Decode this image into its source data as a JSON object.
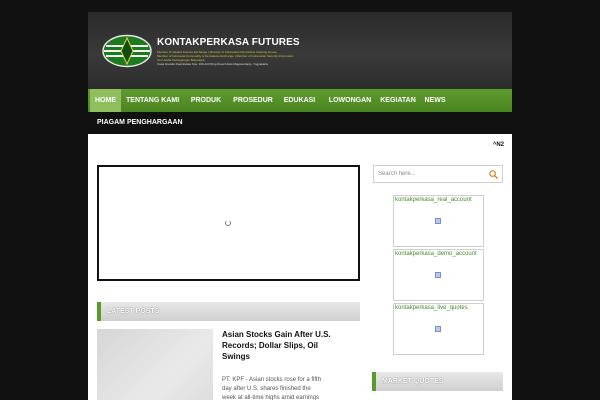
{
  "brand": {
    "name": "KONTAKPERKASA FUTURES",
    "lines": [
      "Member of Jakarta Futures Exchange | Member of Indonesian Derivatives Clearing House",
      "Member of Indonesia Commodity & Derivatives Exchange | Member of Indonesian Security Information",
      "Izin Usaha Perdagangan Berjangka",
      "Casa Grande Real Estate Kav. 109-110 Ring Road Utara Maguwoharjo, Yogyakarta"
    ]
  },
  "nav": {
    "items": [
      "HOME",
      "TENTANG KAMI",
      "PRODUK",
      "PROSEDUR",
      "EDUKASI",
      "LOWONGAN",
      "KEGIATAN",
      "NEWS"
    ],
    "active": "HOME",
    "subitems": [
      "PIAGAM PENGHARGAAN"
    ]
  },
  "ticker": {
    "text": "^N2"
  },
  "sections": {
    "latest_posts": "LATEST POSTS",
    "market_quotes": "MARKET QUOTES"
  },
  "post": {
    "title": "Asian Stocks Gain After U.S. Records; Dollar Slips, Oil Swings",
    "excerpt": "PT. KPF - Asian stocks rose for a fifth day after U.S. shares finished the week at all-time highs amid earnings reports and data that"
  },
  "search": {
    "placeholder": "Search here..."
  },
  "widgets": [
    {
      "label": "kontakperkasa_real_account"
    },
    {
      "label": "kontakperkasa_demo_account"
    },
    {
      "label": "kontakperkasa_live_quotes"
    }
  ],
  "colors": {
    "nav_green": "#5a9a2a",
    "nav_active": "#8fbf5c",
    "accent_bar": "#5a9a2a",
    "background": "#111111"
  }
}
